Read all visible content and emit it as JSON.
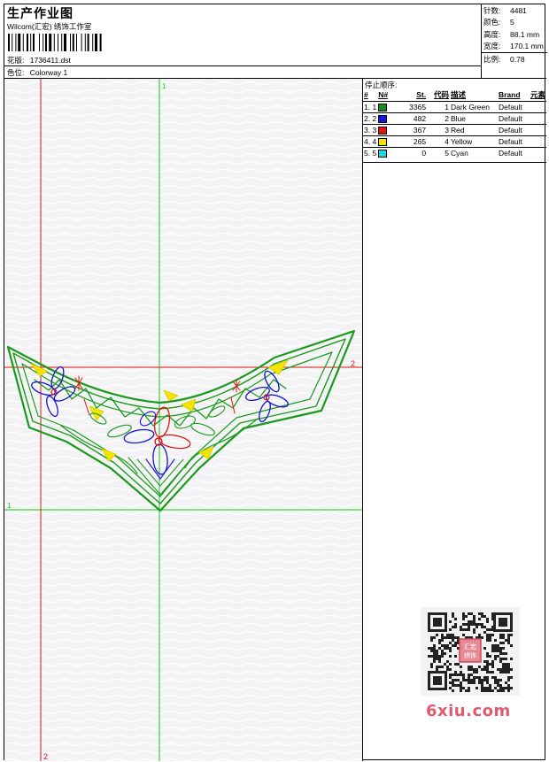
{
  "header": {
    "title": "生产作业图",
    "studio": "Wilcom(汇宏) 绣饰工作室",
    "design_label": "花版:",
    "design_file": "1736411.dst",
    "colorway_label": "色位:",
    "colorway": "Colorway 1"
  },
  "specs": {
    "stitches_label": "针数:",
    "stitches": "4481",
    "colors_label": "颜色:",
    "colors": "5",
    "height_label": "高度:",
    "height": "88.1 mm",
    "width_label": "宽度:",
    "width": "170.1 mm",
    "scale_label": "比例:",
    "scale": "0.78"
  },
  "stop_sequence": {
    "title": "停止顺序:",
    "headers": [
      "#",
      "N#",
      "St.",
      "代码",
      "描述",
      "Brand",
      "元素"
    ],
    "rows": [
      {
        "idx": "1. 1",
        "color": "#1a8a1a",
        "stitches": "3365",
        "code": "1",
        "desc": "Dark Green",
        "brand": "Default"
      },
      {
        "idx": "2. 2",
        "color": "#1414d4",
        "stitches": "482",
        "code": "2",
        "desc": "Blue",
        "brand": "Default"
      },
      {
        "idx": "3. 3",
        "color": "#e01414",
        "stitches": "367",
        "code": "3",
        "desc": "Red",
        "brand": "Default"
      },
      {
        "idx": "4. 4",
        "color": "#f2e600",
        "stitches": "265",
        "code": "4",
        "desc": "Yellow",
        "brand": "Default"
      },
      {
        "idx": "5. 5",
        "color": "#1ed8e0",
        "stitches": "0",
        "code": "5",
        "desc": "Cyan",
        "brand": "Default"
      }
    ]
  },
  "guides": {
    "green_top": "1",
    "green_left": "1",
    "red_right": "2",
    "red_bottom": "2"
  },
  "watermark": {
    "text": "6xiu.com",
    "stamp": "汇宏绣饰"
  },
  "colors": {
    "guide_green": "#16c816",
    "guide_red": "#e01414",
    "thread_green": "#1a9a1a",
    "thread_blue": "#1414d4",
    "thread_red": "#e01414",
    "thread_yellow": "#f2e600"
  }
}
